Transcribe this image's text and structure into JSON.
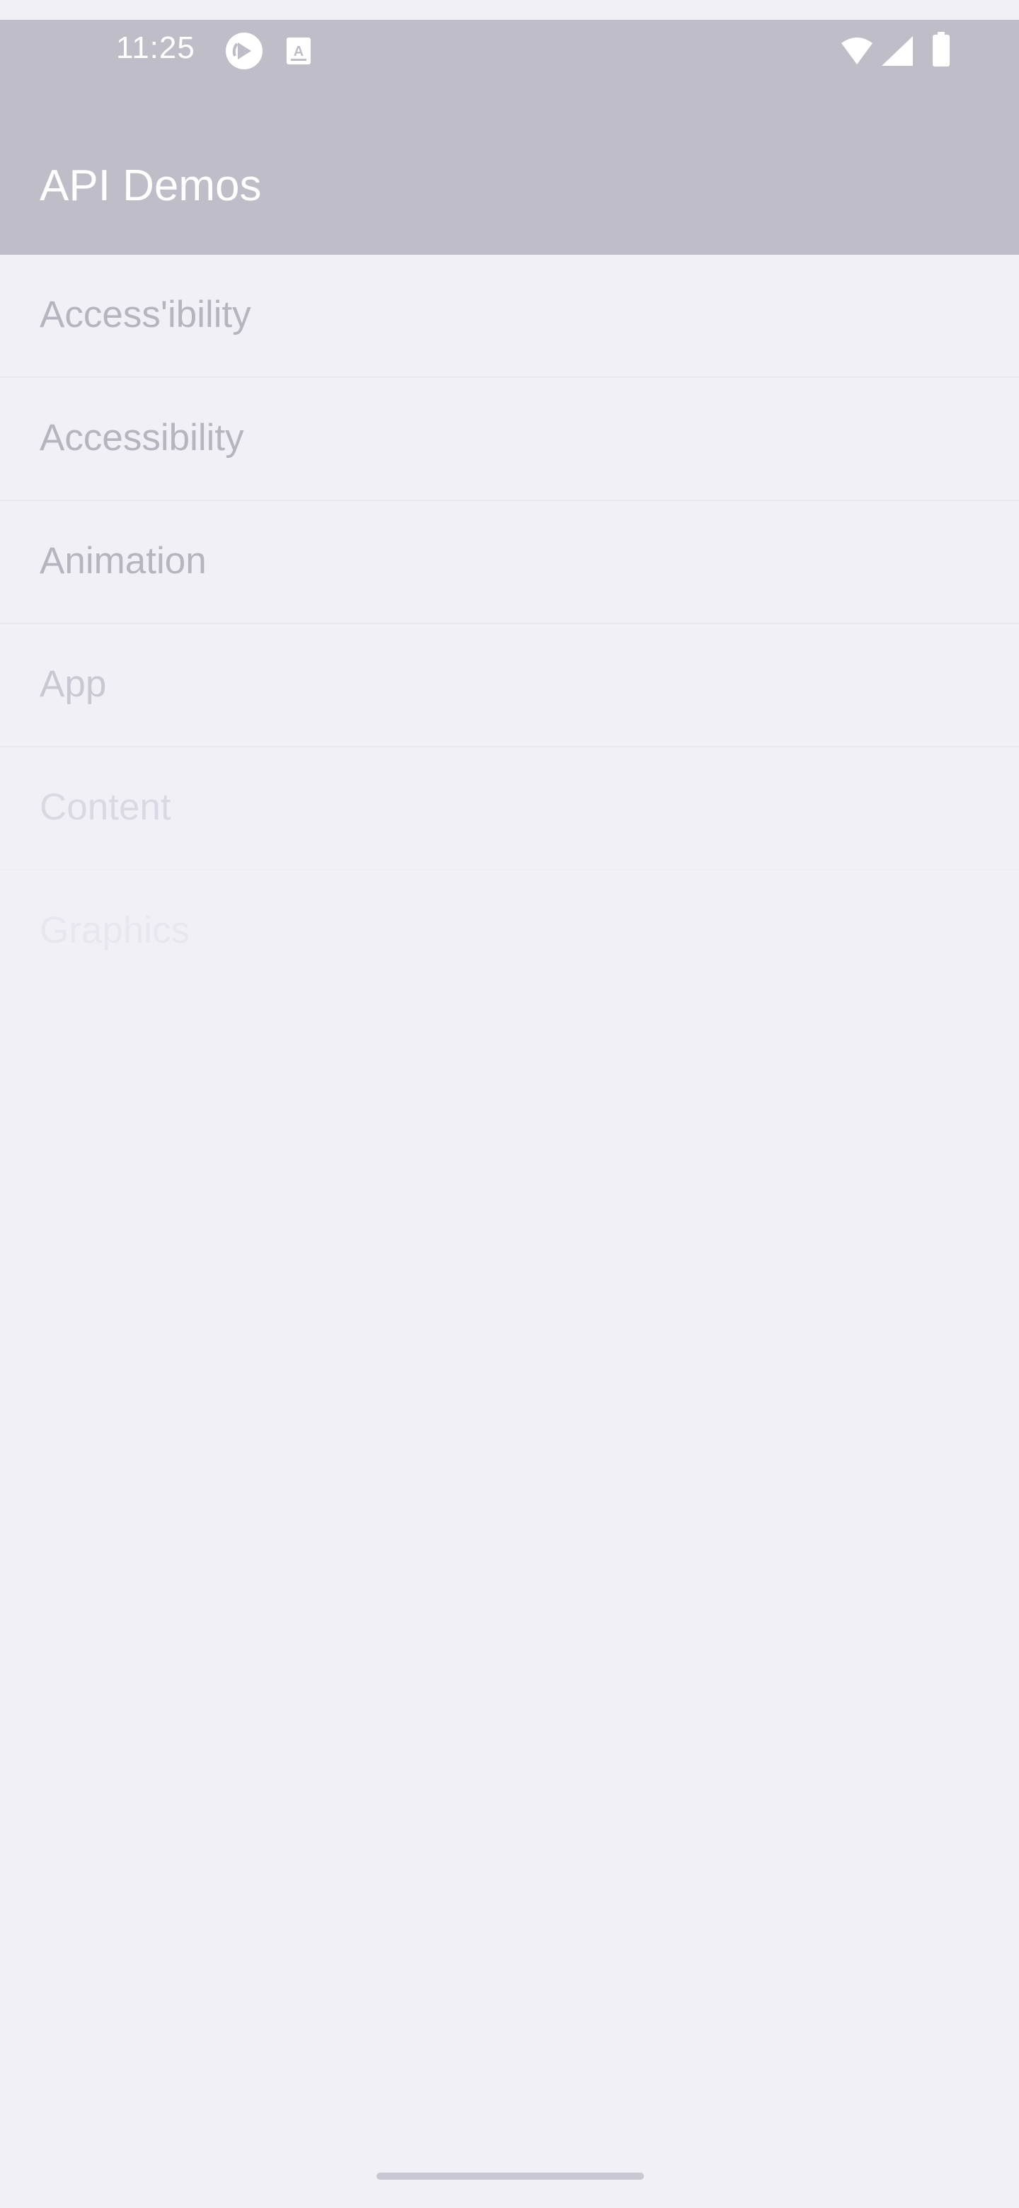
{
  "status_bar": {
    "time": "11:25",
    "icons": [
      "sync-app-icon",
      "keyboard-a-icon",
      "wifi-icon",
      "cell-signal-icon",
      "battery-icon"
    ]
  },
  "header": {
    "title": "API Demos"
  },
  "list": {
    "items": [
      {
        "label": "Access'ibility"
      },
      {
        "label": "Accessibility"
      },
      {
        "label": "Animation"
      },
      {
        "label": "App"
      },
      {
        "label": "Content"
      },
      {
        "label": "Graphics"
      }
    ]
  },
  "colors": {
    "header_background": "#bebdc8",
    "page_background": "#f1f0f7",
    "list_text": "#b6b5bf"
  }
}
